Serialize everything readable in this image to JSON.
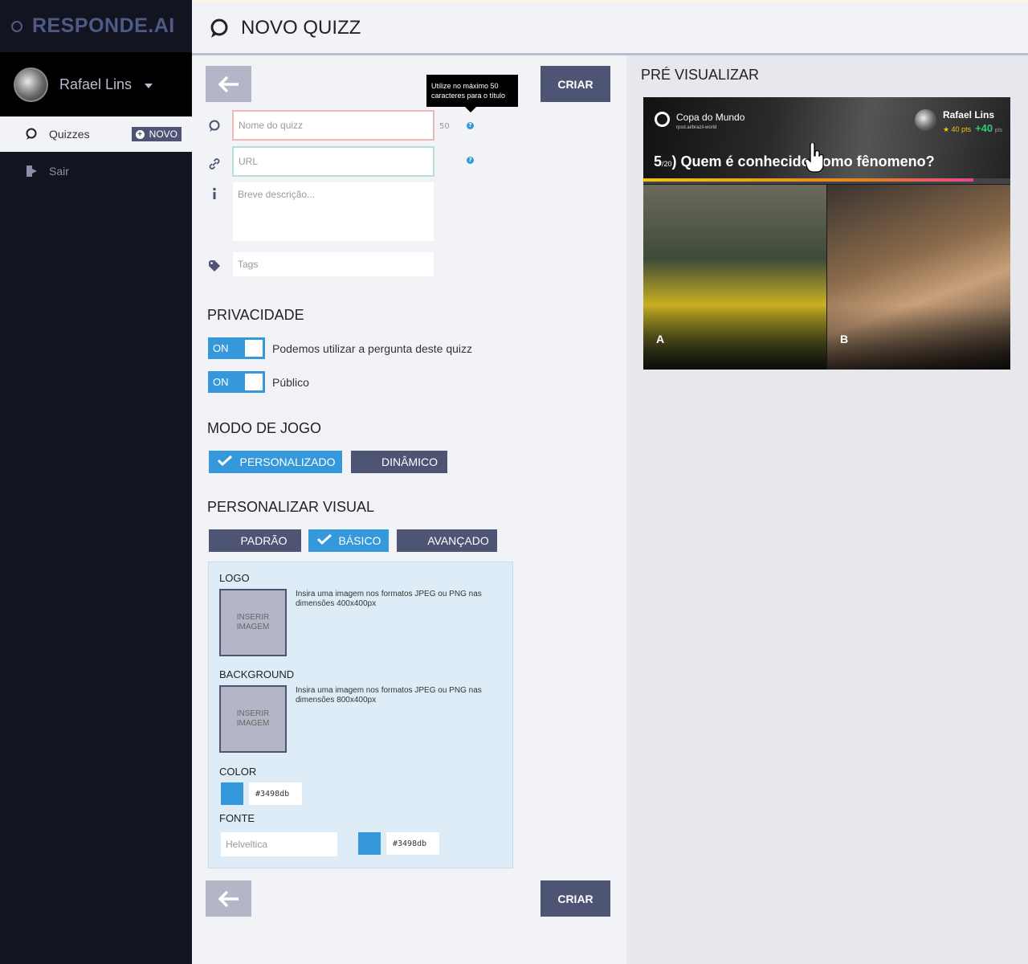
{
  "app": {
    "brand": "RESPONDE.AI"
  },
  "user": {
    "name": "Rafael Lins"
  },
  "sidebar": {
    "items": [
      {
        "label": "Quizzes",
        "badge": "NOVO"
      },
      {
        "label": "Sair"
      }
    ]
  },
  "header": {
    "title": "NOVO QUIZZ"
  },
  "form": {
    "create_label": "CRIAR",
    "tooltip": "Utilize no máximo 50 caracteres para o título",
    "name_placeholder": "Nome do quizz",
    "name_counter": "50",
    "url_placeholder": "URL",
    "description_placeholder": "Breve descrição...",
    "tags_placeholder": "Tags",
    "help_glyph": "?"
  },
  "privacy": {
    "title": "PRIVACIDADE",
    "toggles": [
      {
        "state": "ON",
        "label": "Podemos utilizar a pergunta deste quizz"
      },
      {
        "state": "ON",
        "label": "Público"
      }
    ]
  },
  "game_mode": {
    "title": "MODO DE JOGO",
    "options": [
      "PERSONALIZADO",
      "DINÂMICO"
    ],
    "selected": "PERSONALIZADO"
  },
  "visual": {
    "title": "PERSONALIZAR VISUAL",
    "options": [
      "PADRÃO",
      "BÁSICO",
      "AVANÇADO"
    ],
    "selected": "BÁSICO",
    "logo_label": "LOGO",
    "logo_box": "INSERIR IMAGEM",
    "logo_hint": "Insira uma imagem nos formatos JPEG ou PNG nas dimensões 400x400px",
    "bg_label": "BACKGROUND",
    "bg_box": "INSERIR IMAGEM",
    "bg_hint": "Insira uma imagem nos formatos JPEG ou PNG nas dimensões 800x400px",
    "color_label": "COLOR",
    "color_value": "#3498db",
    "font_label": "FONTE",
    "font_placeholder": "Helveltica",
    "font_color_value": "#3498db"
  },
  "preview": {
    "title": "PRÉ VISUALIZAR",
    "quiz_name": "Copa do Mundo",
    "quiz_url": "rpsd.ai/brazil-world",
    "user_name": "Rafael Lins",
    "points": "40 pts",
    "points_gain": "+40",
    "points_gain_unit": "pts",
    "question_index": "5",
    "question_total": "/20",
    "question_text": "Quem é conhecido como fênomeno?",
    "progress": 0.9,
    "option_a": "A",
    "option_b": "B"
  },
  "colors": {
    "accent": "#3498db",
    "dark": "#4e5474",
    "sidebar": "#12141f"
  }
}
